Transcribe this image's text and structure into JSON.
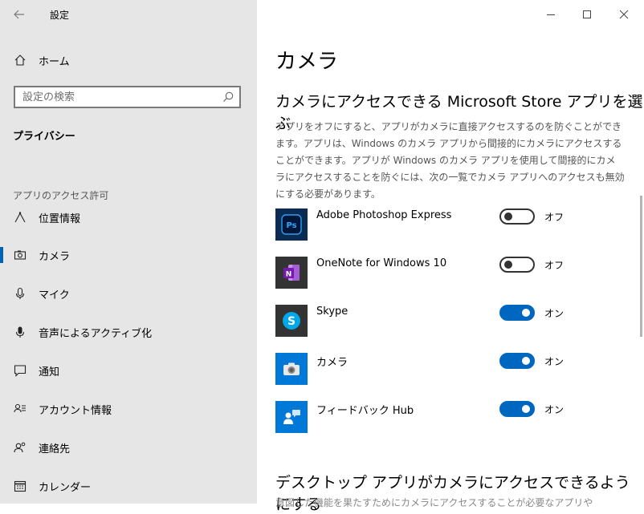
{
  "window": {
    "title": "設定"
  },
  "sidebar": {
    "home_label": "ホーム",
    "search_placeholder": "設定の検索",
    "section_title": "プライバシー",
    "group_label": "アプリのアクセス許可",
    "items": [
      {
        "label": "位置情報",
        "icon": "location-icon",
        "selected": false
      },
      {
        "label": "カメラ",
        "icon": "camera-icon",
        "selected": true
      },
      {
        "label": "マイク",
        "icon": "microphone-icon",
        "selected": false
      },
      {
        "label": "音声によるアクティブ化",
        "icon": "voice-icon",
        "selected": false
      },
      {
        "label": "通知",
        "icon": "notification-icon",
        "selected": false
      },
      {
        "label": "アカウント情報",
        "icon": "account-info-icon",
        "selected": false
      },
      {
        "label": "連絡先",
        "icon": "contacts-icon",
        "selected": false
      },
      {
        "label": "カレンダー",
        "icon": "calendar-icon",
        "selected": false
      }
    ]
  },
  "main": {
    "page_title": "カメラ",
    "sub_heading": "カメラにアクセスできる Microsoft Store アプリを選ぶ",
    "description": "アプリをオフにすると、アプリがカメラに直接アクセスするのを防ぐことができます。アプリは、Windows のカメラ アプリから間接的にカメラにアクセスすることができます。アプリが Windows のカメラ アプリを使用して間接的にカメラにアクセスすることを防ぐには、次の一覧でカメラ アプリへのアクセスも無効にする必要があります。",
    "apps": [
      {
        "name": "Adobe Photoshop Express",
        "state": "オフ",
        "on": false,
        "icon": "photoshop-express-icon",
        "tile_color": "#0b2b52"
      },
      {
        "name": "OneNote for Windows 10",
        "state": "オフ",
        "on": false,
        "icon": "onenote-icon",
        "tile_color": "#333333"
      },
      {
        "name": "Skype",
        "state": "オン",
        "on": true,
        "icon": "skype-icon",
        "tile_color": "#333333"
      },
      {
        "name": "カメラ",
        "state": "オン",
        "on": true,
        "icon": "camera-app-icon",
        "tile_color": "#0078d7"
      },
      {
        "name": "フィードバック Hub",
        "state": "オン",
        "on": true,
        "icon": "feedback-hub-icon",
        "tile_color": "#0078d7"
      }
    ],
    "desktop_heading": "デスクトップ アプリがカメラにアクセスできるようにする",
    "desktop_desc": "意図した機能を果たすためにカメラにアクセスすることが必要なアプリや"
  },
  "colors": {
    "accent": "#0067c0",
    "sidebar_bg": "#e6e6e6"
  }
}
